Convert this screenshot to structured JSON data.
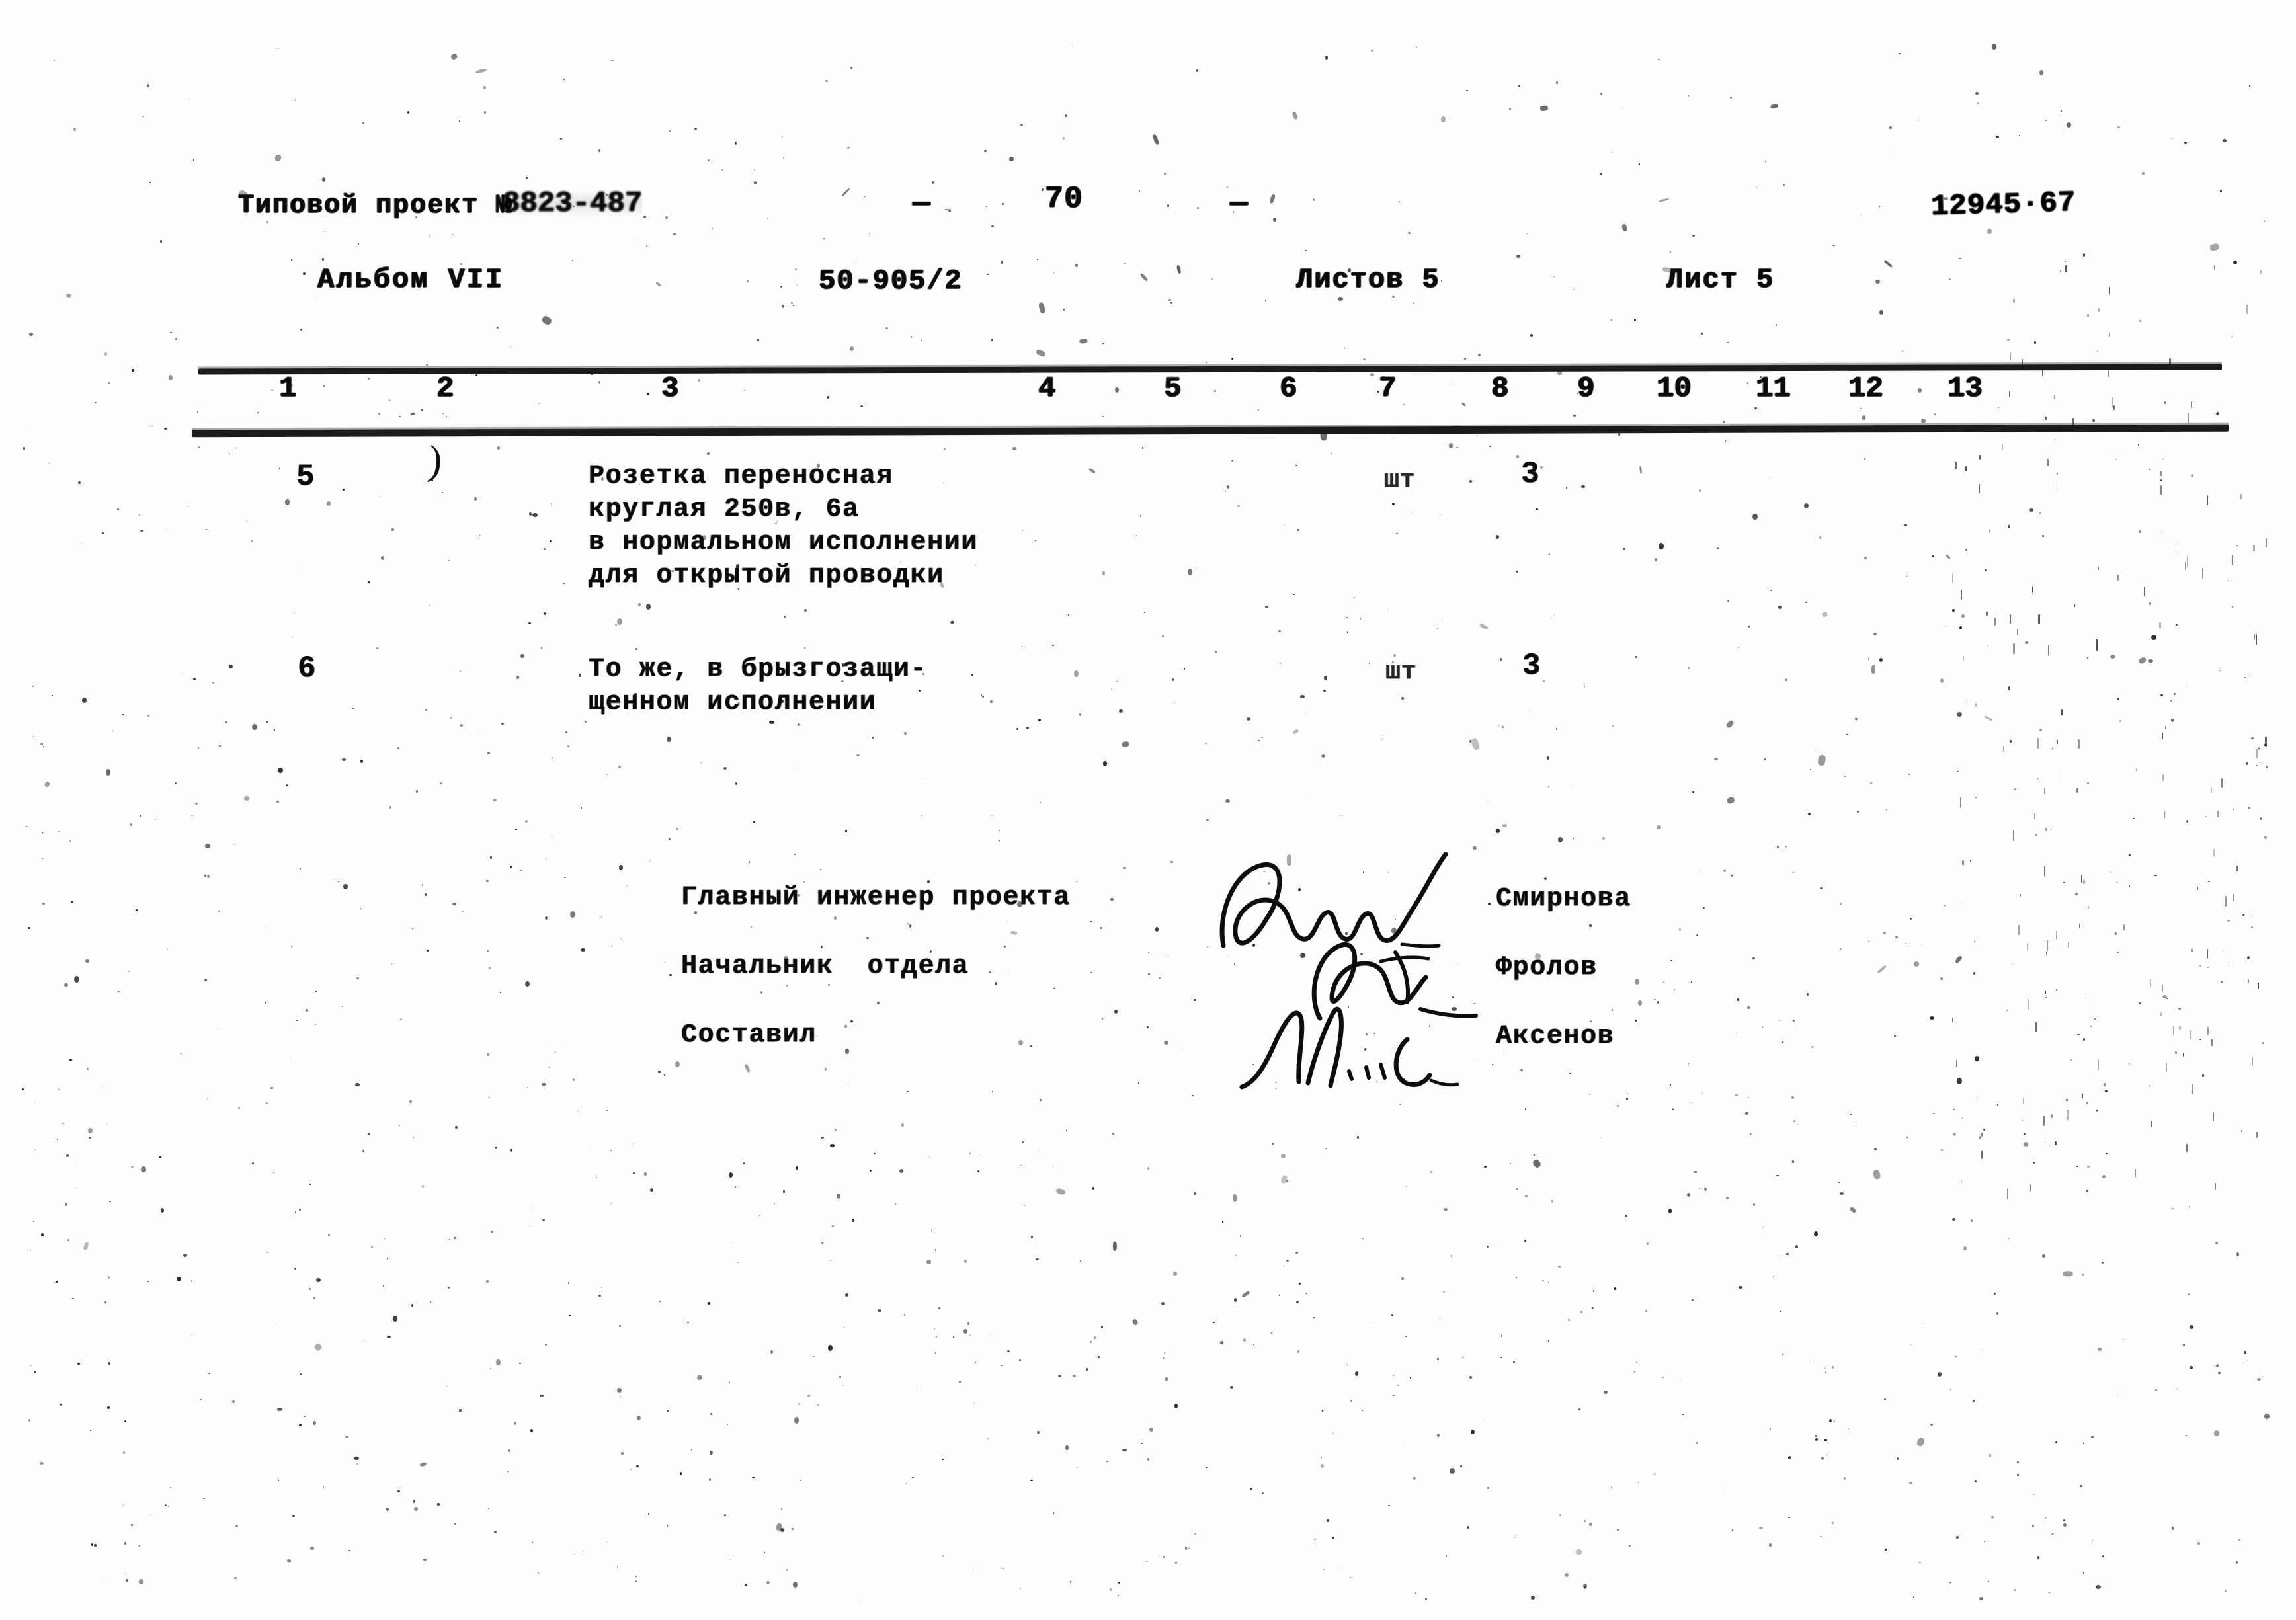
{
  "document": {
    "kind": "scanned-technical-specification-sheet",
    "language": "ru",
    "page_number": "70",
    "dash_left": "—",
    "dash_right": "—"
  },
  "header": {
    "project_label": "Типовой проект №",
    "project_number": "8823-487",
    "album": "Альбом VII",
    "doc_code": "50-905/2",
    "sheets_total": "Листов 5",
    "sheet_current": "Лист 5",
    "stamp": "12945·67"
  },
  "table": {
    "column_numbers": [
      "1",
      "2",
      "3",
      "4",
      "5",
      "6",
      "7",
      "8",
      "9",
      "10",
      "11",
      "12",
      "13"
    ],
    "rows": [
      {
        "number": "5",
        "description": "Розетка переносная\nкруглая 250в, 6а\nв нормальном исполнении\nдля открытой проводки",
        "unit": "шт",
        "quantity": "3"
      },
      {
        "number": "6",
        "description": "То же, в брызгозащи-\nщенном исполнении",
        "unit": "шт",
        "quantity": "3"
      }
    ]
  },
  "signatures": [
    {
      "role": "Главный инженер проекта",
      "name": "Смирнова",
      "mark": "signature-scrawl"
    },
    {
      "role": "Начальник  отдела",
      "name": "Фролов",
      "mark": "signature-scrawl"
    },
    {
      "role": "Составил",
      "name": "Аксенов",
      "mark": "signature-scrawl"
    }
  ]
}
